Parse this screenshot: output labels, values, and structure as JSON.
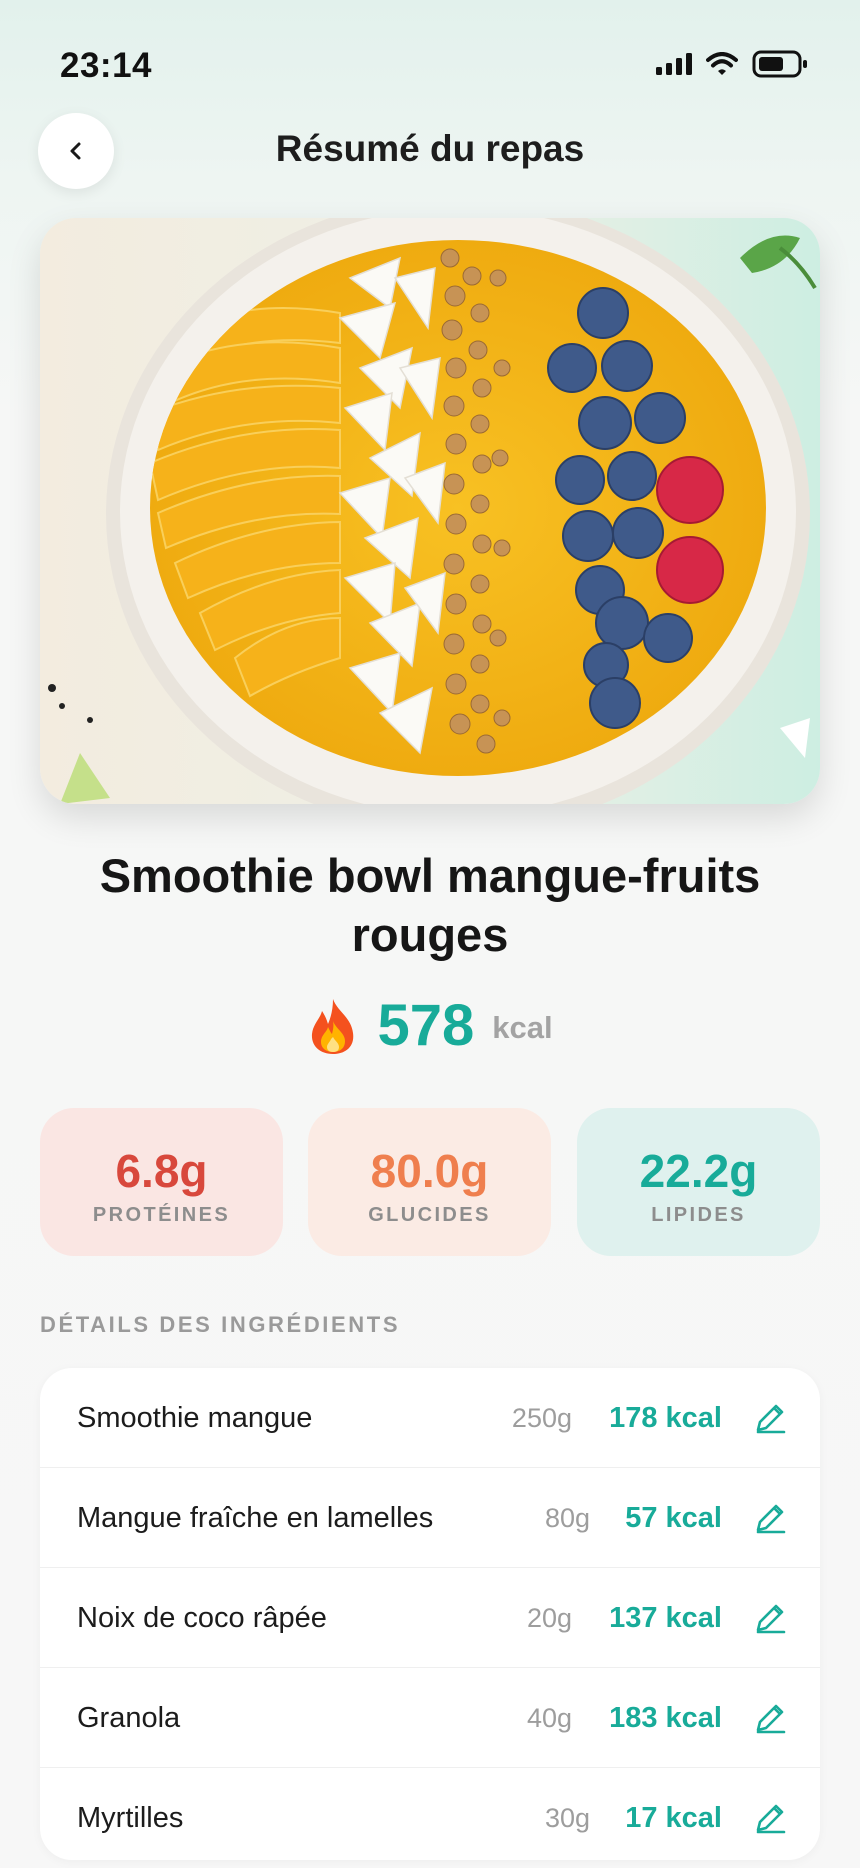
{
  "status_bar": {
    "time": "23:14"
  },
  "header": {
    "title": "Résumé du repas"
  },
  "meal": {
    "name": "Smoothie bowl mangue-fruits rouges",
    "calories": "578",
    "calories_unit": "kcal",
    "calorie_icon": "fire-emoji"
  },
  "macros": [
    {
      "value": "6.8g",
      "label": "PROTÉINES",
      "color": "#d8483c",
      "bg": "#fae6e3"
    },
    {
      "value": "80.0g",
      "label": "GLUCIDES",
      "color": "#ef7f4e",
      "bg": "#fbebe4"
    },
    {
      "value": "22.2g",
      "label": "LIPIDES",
      "color": "#18ab99",
      "bg": "#dff1ee"
    }
  ],
  "ingredients_section": {
    "title": "DÉTAILS DES INGRÉDIENTS",
    "items": [
      {
        "name": "Smoothie mangue",
        "quantity": "250g",
        "kcal": "178 kcal"
      },
      {
        "name": "Mangue fraîche en lamelles",
        "quantity": "80g",
        "kcal": "57 kcal"
      },
      {
        "name": "Noix de coco râpée",
        "quantity": "20g",
        "kcal": "137 kcal"
      },
      {
        "name": "Granola",
        "quantity": "40g",
        "kcal": "183 kcal"
      },
      {
        "name": "Myrtilles",
        "quantity": "30g",
        "kcal": "17 kcal"
      }
    ]
  },
  "colors": {
    "accent": "#18ab99"
  }
}
